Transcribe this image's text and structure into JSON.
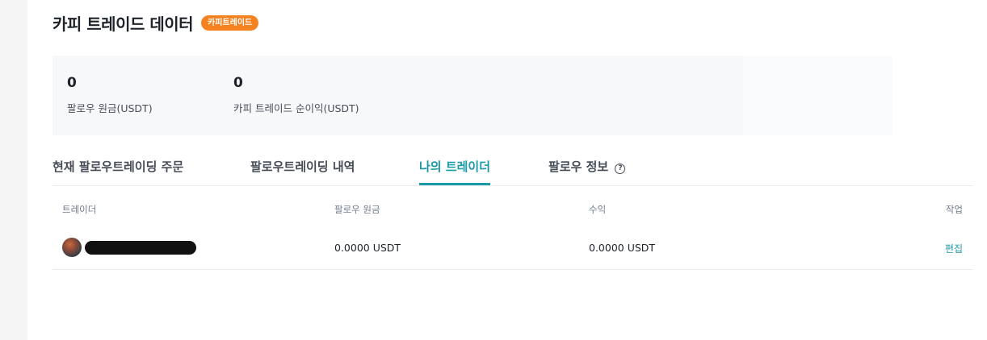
{
  "header": {
    "title": "카피 트레이드 데이터",
    "badge": "카피트레이드"
  },
  "stats": [
    {
      "value": "0",
      "label": "팔로우 원금(USDT)"
    },
    {
      "value": "0",
      "label": "카피 트레이드 순이익(USDT)"
    }
  ],
  "tabs": [
    {
      "label": "현재 팔로우트레이딩 주문",
      "active": false
    },
    {
      "label": "팔로우트레이딩 내역",
      "active": false
    },
    {
      "label": "나의 트레이더",
      "active": true
    },
    {
      "label": "팔로우 정보",
      "active": false
    }
  ],
  "table": {
    "headers": [
      "트레이더",
      "팔로우 원금",
      "수익",
      "작업"
    ],
    "rows": [
      {
        "principal": "0.0000 USDT",
        "profit": "0.0000 USDT",
        "action": "편집"
      }
    ]
  },
  "colors": {
    "accent": "#1a9aa6",
    "badge": "#f58220"
  },
  "icons": {
    "help": "question-circle-icon"
  }
}
